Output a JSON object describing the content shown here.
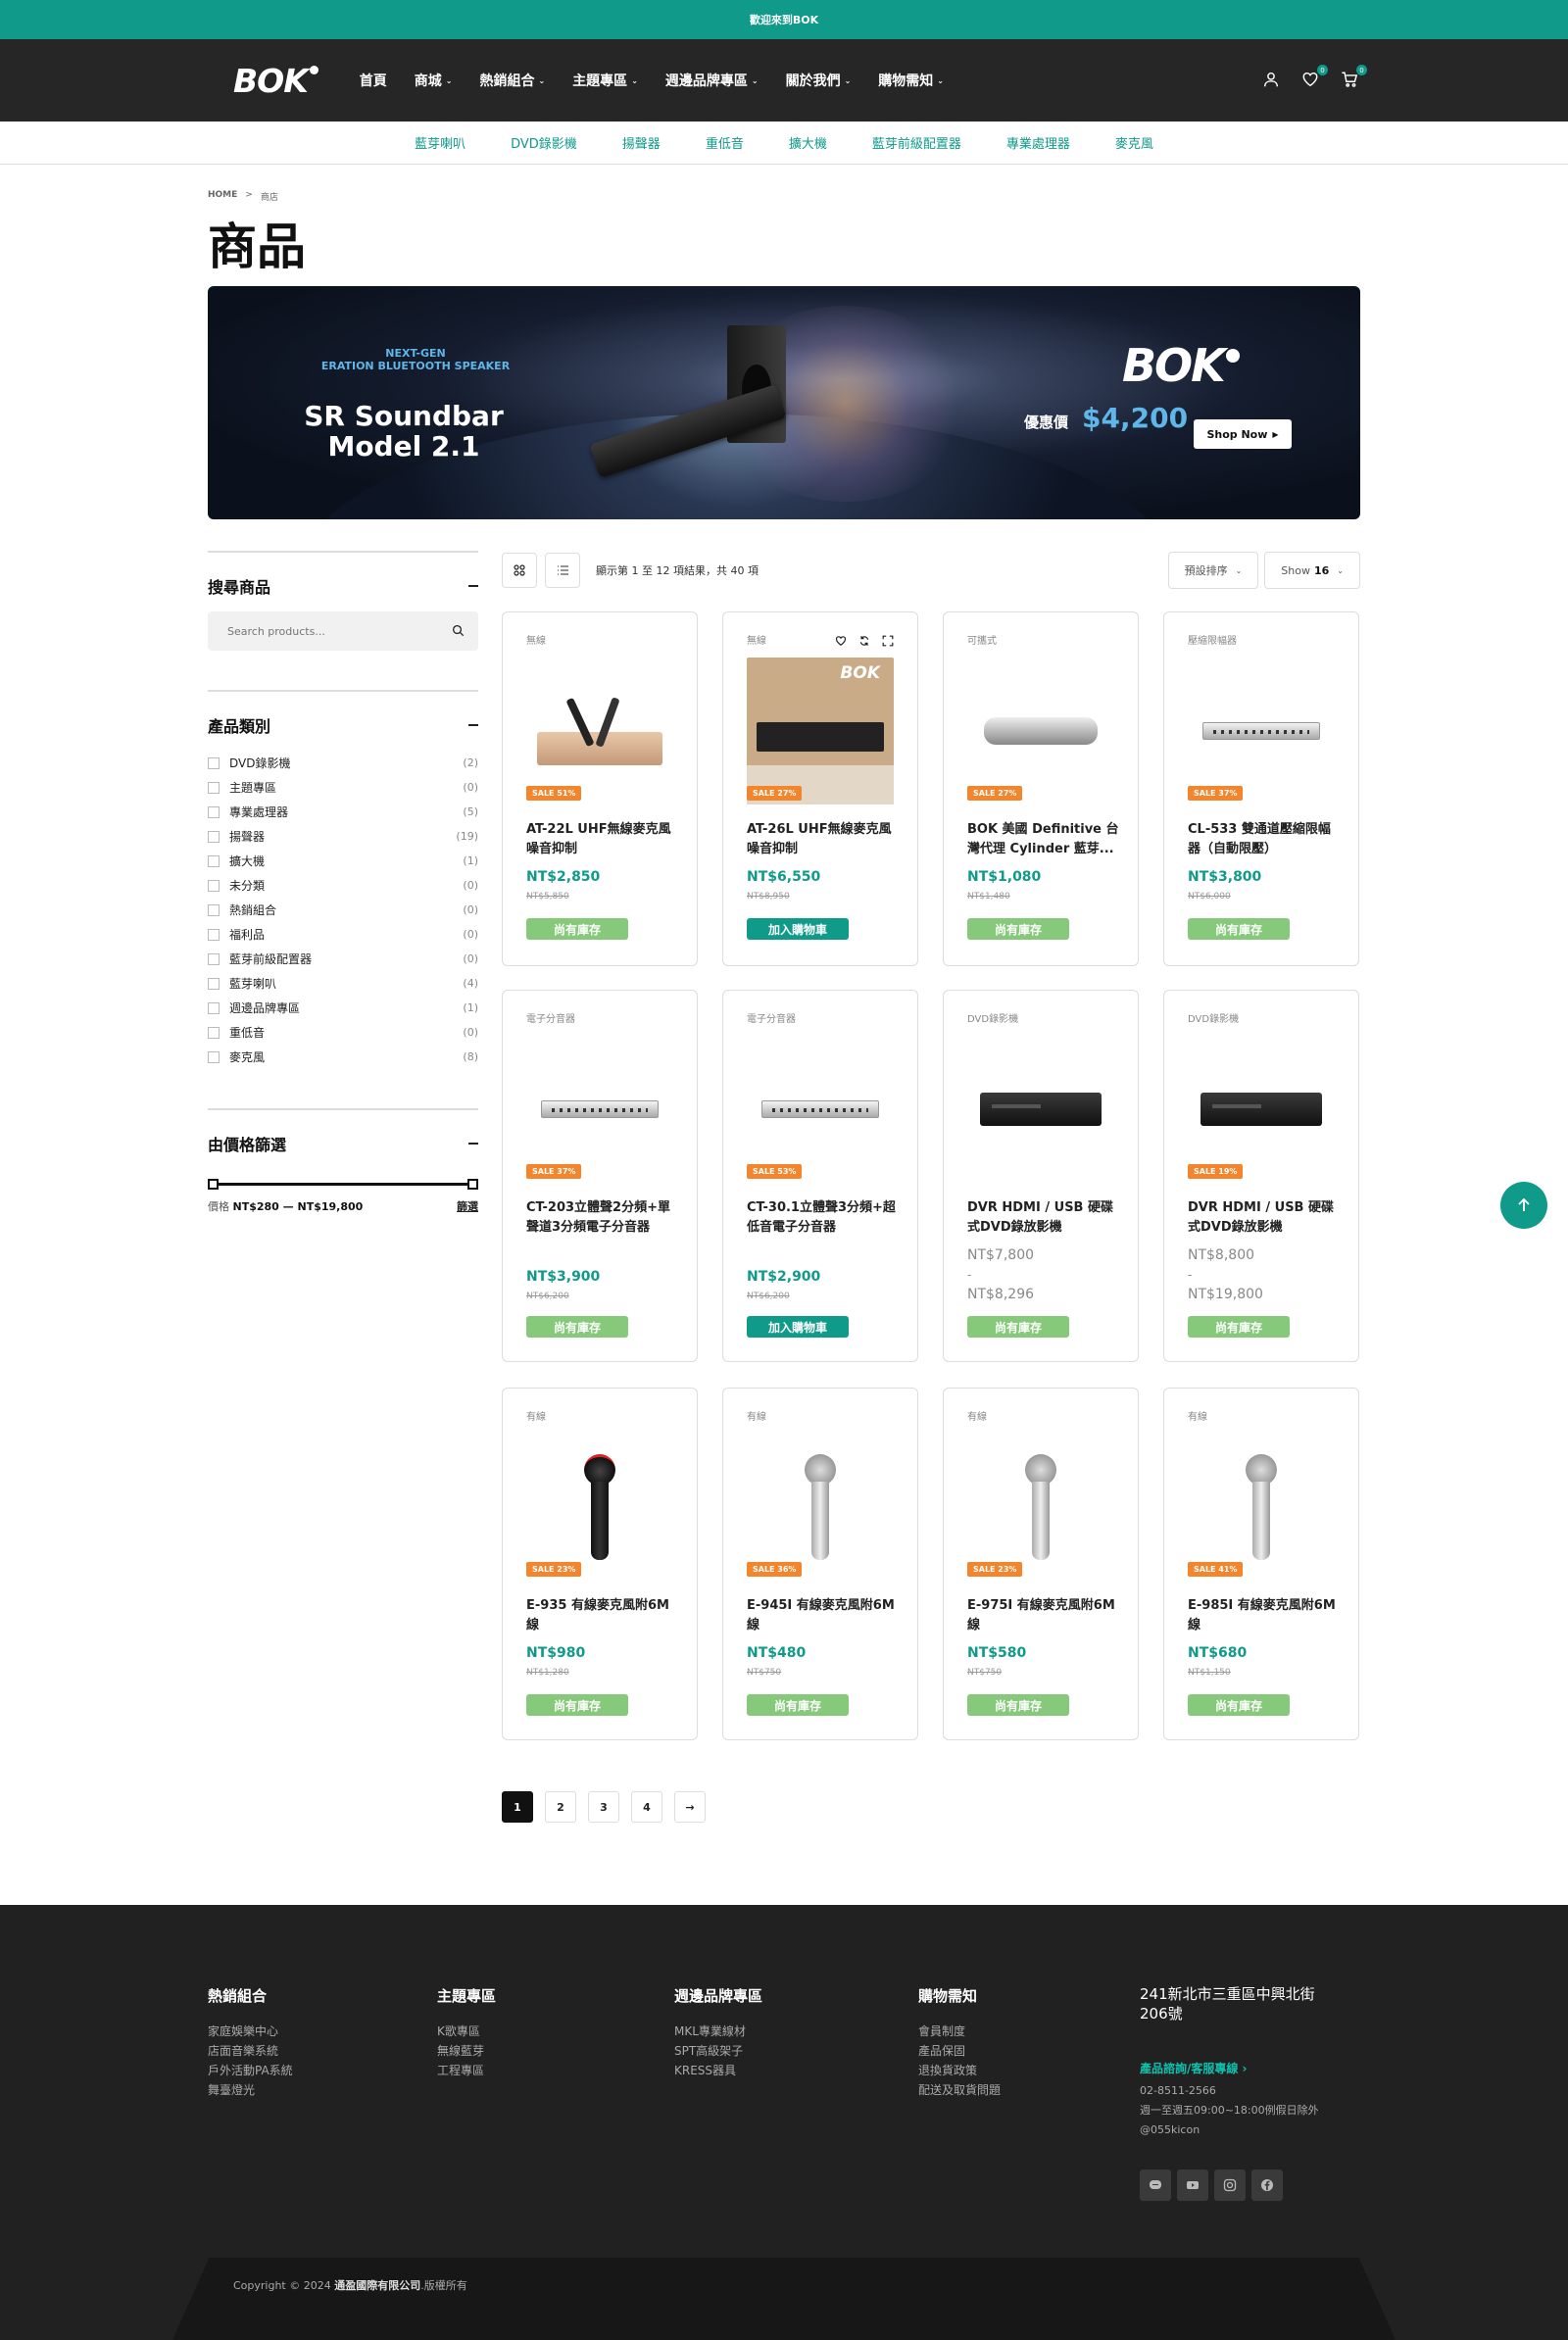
{
  "announcement": "歡迎來到BOK",
  "logo_text": "BOK",
  "nav": [
    {
      "label": "首頁",
      "has_dropdown": false
    },
    {
      "label": "商城",
      "has_dropdown": true
    },
    {
      "label": "熱銷組合",
      "has_dropdown": true
    },
    {
      "label": "主題專區",
      "has_dropdown": true
    },
    {
      "label": "週邊品牌專區",
      "has_dropdown": true
    },
    {
      "label": "關於我們",
      "has_dropdown": true
    },
    {
      "label": "購物需知",
      "has_dropdown": true
    }
  ],
  "header_icons": {
    "user": "user-icon",
    "wishlist": "heart-icon",
    "wishlist_count": "0",
    "cart": "cart-icon",
    "cart_count": "0"
  },
  "subnav": [
    "藍芽喇叭",
    "DVD錄影機",
    "揚聲器",
    "重低音",
    "擴大機",
    "藍芽前級配置器",
    "專業處理器",
    "麥克風"
  ],
  "breadcrumb": {
    "home": "HOME",
    "sep": ">",
    "current": "商店"
  },
  "page_title": "商品",
  "banner": {
    "tagline": "NEXT-GEN\nERATION BLUETOOTH SPEAKER",
    "product": "SR Soundbar\nModel 2.1",
    "brand": "BOK",
    "price_label": "優惠價",
    "price": "$4,200",
    "cta": "Shop Now"
  },
  "sidebar": {
    "search_title": "搜尋商品",
    "search_placeholder": "Search products...",
    "category_title": "產品類別",
    "categories": [
      {
        "name": "DVD錄影機",
        "count": "(2)"
      },
      {
        "name": "主題專區",
        "count": "(0)"
      },
      {
        "name": "專業處理器",
        "count": "(5)"
      },
      {
        "name": "揚聲器",
        "count": "(19)"
      },
      {
        "name": "擴大機",
        "count": "(1)"
      },
      {
        "name": "未分類",
        "count": "(0)"
      },
      {
        "name": "熱銷組合",
        "count": "(0)"
      },
      {
        "name": "福利品",
        "count": "(0)"
      },
      {
        "name": "藍芽前級配置器",
        "count": "(0)"
      },
      {
        "name": "藍芽喇叭",
        "count": "(4)"
      },
      {
        "name": "週邊品牌專區",
        "count": "(1)"
      },
      {
        "name": "重低音",
        "count": "(0)"
      },
      {
        "name": "麥克風",
        "count": "(8)"
      }
    ],
    "price_title": "由價格篩選",
    "price_label": "價格",
    "price_range": "NT$280 — NT$19,800",
    "filter_label": "篩選"
  },
  "toolbar": {
    "result_text": "顯示第 1 至 12 項結果，共 40 項",
    "sort_label": "預設排序",
    "show_label": "Show",
    "show_value": "16"
  },
  "products": [
    {
      "category": "無線",
      "name": "AT-22L UHF無線麥克風噪音抑制",
      "price": "NT$2,850",
      "old": "NT$5,850",
      "sale": "SALE 51%",
      "button": "尚有庫存",
      "button_type": "stock",
      "image": "mic-set"
    },
    {
      "category": "無線",
      "name": "AT-26L UHF無線麥克風噪音抑制",
      "price": "NT$6,550",
      "old": "NT$8,950",
      "sale": "SALE 27%",
      "button": "加入購物車",
      "button_type": "cart",
      "image": "boxart",
      "box_brand": "BOK"
    },
    {
      "category": "可攜式",
      "name": "BOK 美國 Definitive 台灣代理 Cylinder 藍芽...",
      "price": "NT$1,080",
      "old": "NT$1,480",
      "sale": "SALE 27%",
      "button": "尚有庫存",
      "button_type": "stock",
      "image": "bar-speaker"
    },
    {
      "category": "壓縮限幅器",
      "name": "CL-533 雙通道壓縮限幅器（自動限壓）",
      "price": "NT$3,800",
      "old": "NT$6,000",
      "sale": "SALE 37%",
      "button": "尚有庫存",
      "button_type": "stock",
      "image": "rack"
    },
    {
      "category": "電子分音器",
      "name": "CT-203立體聲2分頻+單聲道3分頻電子分音器",
      "price": "NT$3,900",
      "old": "NT$6,200",
      "sale": "SALE 37%",
      "button": "尚有庫存",
      "button_type": "stock",
      "image": "rack"
    },
    {
      "category": "電子分音器",
      "name": "CT-30.1立體聲3分頻+超低音電子分音器",
      "price": "NT$2,900",
      "old": "NT$6,200",
      "sale": "SALE 53%",
      "button": "加入購物車",
      "button_type": "cart",
      "image": "rack"
    },
    {
      "category": "DVD錄影機",
      "name": "DVR HDMI / USB 硬碟式DVD錄放影機",
      "price_from": "NT$7,800",
      "dash": "-",
      "price_to": "NT$8,296",
      "button": "尚有庫存",
      "button_type": "stock",
      "image": "dvd"
    },
    {
      "category": "DVD錄影機",
      "name": "DVR HDMI / USB 硬碟式DVD錄放影機",
      "price_from": "NT$8,800",
      "dash": "-",
      "price_to": "NT$19,800",
      "sale": "SALE 19%",
      "button": "尚有庫存",
      "button_type": "stock",
      "image": "dvd"
    },
    {
      "category": "有線",
      "name": "E-935 有線麥克風附6M線",
      "price": "NT$980",
      "old": "NT$1,280",
      "sale": "SALE 23%",
      "button": "尚有庫存",
      "button_type": "stock",
      "image": "handmic-black"
    },
    {
      "category": "有線",
      "name": "E-945I 有線麥克風附6M線",
      "price": "NT$480",
      "old": "NT$750",
      "sale": "SALE 36%",
      "button": "尚有庫存",
      "button_type": "stock",
      "image": "handmic"
    },
    {
      "category": "有線",
      "name": "E-975I 有線麥克風附6M線",
      "price": "NT$580",
      "old": "NT$750",
      "sale": "SALE 23%",
      "button": "尚有庫存",
      "button_type": "stock",
      "image": "handmic"
    },
    {
      "category": "有線",
      "name": "E-985I 有線麥克風附6M線",
      "price": "NT$680",
      "old": "NT$1,150",
      "sale": "SALE 41%",
      "button": "尚有庫存",
      "button_type": "stock",
      "image": "handmic"
    }
  ],
  "pagination": [
    "1",
    "2",
    "3",
    "4",
    "→"
  ],
  "footer": {
    "cols": [
      {
        "title": "熱銷組合",
        "links": [
          "家庭娛樂中心",
          "店面音樂系統",
          "戶外活動PA系統",
          "舞臺燈光"
        ]
      },
      {
        "title": "主題專區",
        "links": [
          "K歌專區",
          "無線藍芽",
          "工程專區"
        ]
      },
      {
        "title": "週邊品牌專區",
        "links": [
          "MKL專業線材",
          "SPT高級架子",
          "KRESS器具"
        ]
      },
      {
        "title": "購物需知",
        "links": [
          "會員制度",
          "產品保固",
          "退換貨政策",
          "配送及取貨問題"
        ]
      }
    ],
    "address": "241新北市三重區中興北街206號",
    "support": "產品諮詢/客服專線 ›",
    "phone": "02-8511-2566",
    "hours": "週一至週五09:00~18:00例假日除外",
    "line": "@055kicon",
    "socials": [
      "line-icon",
      "youtube-icon",
      "instagram-icon",
      "facebook-icon"
    ],
    "copyright_prefix": "Copyright © 2024",
    "company": "通盈國際有限公司",
    "rights": ".版權所有"
  },
  "colors": {
    "accent": "#0f9a8a",
    "sale": "#f3852c",
    "stock": "#86c97a",
    "banner_price": "#5fb6e8"
  }
}
